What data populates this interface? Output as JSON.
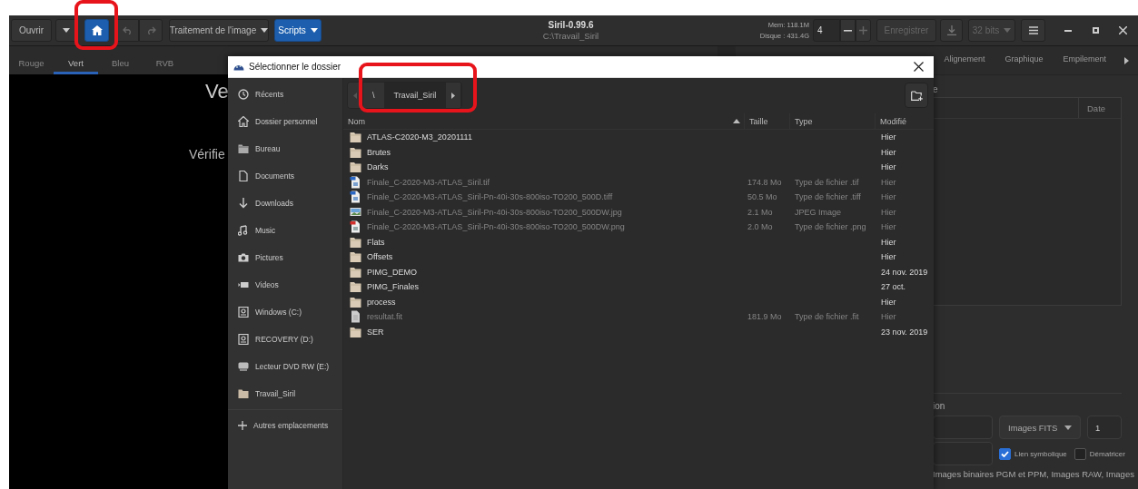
{
  "header": {
    "open_button": "Ouvrir",
    "undo_disabled": true,
    "redo_disabled": true,
    "processing_menu": "Traitement de l'image",
    "scripts_menu": "Scripts",
    "title": "Siril-0.99.6",
    "subtitle": "C:\\Travail_Siril",
    "memory": "Mem: 118.1M",
    "disk": "Disque : 431.4G",
    "threads": "4",
    "save_button": "Enregistrer",
    "save_disabled": true,
    "bit_depth": "32 bits"
  },
  "image_tabs": [
    {
      "label": "Rouge",
      "selected": false
    },
    {
      "label": "Vert",
      "selected": true
    },
    {
      "label": "Bleu",
      "selected": false
    },
    {
      "label": "RVB",
      "selected": false
    }
  ],
  "image_area": {
    "heading": "Ve",
    "message": "Vérifie"
  },
  "panel_tabs": [
    {
      "label": "Alignement",
      "selected": false
    },
    {
      "label": "Graphique",
      "selected": false
    },
    {
      "label": "Empilement",
      "selected": false
    }
  ],
  "panel": {
    "heading": "e",
    "table_column": "Date",
    "section": "ion",
    "file_type": "Images FITS",
    "spin_value": "1",
    "checkboxes": [
      {
        "label": "Lien symbolique",
        "checked": true
      },
      {
        "label": "Dématricer",
        "checked": false
      }
    ],
    "formats": "Images binaires PGM et PPM, Images RAW, Images"
  },
  "dialog": {
    "title": "Sélectionner le dossier",
    "places": [
      {
        "label": "Récents",
        "kind": "recent"
      },
      {
        "label": "Dossier personnel",
        "kind": "home"
      },
      {
        "label": "Bureau",
        "kind": "desktop"
      },
      {
        "label": "Documents",
        "kind": "document"
      },
      {
        "label": "Downloads",
        "kind": "download"
      },
      {
        "label": "Music",
        "kind": "music"
      },
      {
        "label": "Pictures",
        "kind": "pictures"
      },
      {
        "label": "Videos",
        "kind": "videos"
      },
      {
        "label": "Windows (C:)",
        "kind": "drive"
      },
      {
        "label": "RECOVERY (D:)",
        "kind": "drive"
      },
      {
        "label": "Lecteur DVD RW (E:)",
        "kind": "optical"
      },
      {
        "label": "Travail_Siril",
        "kind": "bookmark"
      }
    ],
    "other_locations": "Autres emplacements",
    "path": [
      {
        "label": "\\",
        "selected": false
      },
      {
        "label": "Travail_Siril",
        "selected": true
      }
    ],
    "columns": [
      "Nom",
      "Taille",
      "Type",
      "Modifié"
    ],
    "files": [
      {
        "name": "ATLAS-C2020-M3_20201111",
        "modified": "Hier",
        "kind": "folder",
        "disabled": false
      },
      {
        "name": "Brutes",
        "modified": "Hier",
        "kind": "folder",
        "disabled": false
      },
      {
        "name": "Darks",
        "modified": "Hier",
        "kind": "folder",
        "disabled": false
      },
      {
        "name": "Finale_C-2020-M3-ATLAS_Siril.tif",
        "size": "174.8 Mo",
        "type": "Type de fichier .tif",
        "modified": "Hier",
        "kind": "tiff",
        "disabled": true
      },
      {
        "name": "Finale_C-2020-M3-ATLAS_Siril-Pn-40i-30s-800iso-TO200_500D.tiff",
        "size": "50.5 Mo",
        "type": "Type de fichier .tiff",
        "modified": "Hier",
        "kind": "tiff",
        "disabled": true
      },
      {
        "name": "Finale_C-2020-M3-ATLAS_Siril-Pn-40i-30s-800iso-TO200_500DW.jpg",
        "size": "2.1 Mo",
        "type": "JPEG Image",
        "modified": "Hier",
        "kind": "jpeg",
        "disabled": true
      },
      {
        "name": "Finale_C-2020-M3-ATLAS_Siril-Pn-40i-30s-800iso-TO200_500DW.png",
        "size": "2.0 Mo",
        "type": "Type de fichier .png",
        "modified": "Hier",
        "kind": "png",
        "disabled": true
      },
      {
        "name": "Flats",
        "modified": "Hier",
        "kind": "folder",
        "disabled": false
      },
      {
        "name": "Offsets",
        "modified": "Hier",
        "kind": "folder",
        "disabled": false
      },
      {
        "name": "PIMG_DEMO",
        "modified": "24 nov. 2019",
        "kind": "folder",
        "disabled": false
      },
      {
        "name": "PIMG_Finales",
        "modified": "27 oct.",
        "kind": "folder",
        "disabled": false
      },
      {
        "name": "process",
        "modified": "Hier",
        "kind": "folder",
        "disabled": false
      },
      {
        "name": "resultat.fit",
        "size": "181.9 Mo",
        "type": "Type de fichier .fit",
        "modified": "Hier",
        "kind": "file",
        "disabled": true
      },
      {
        "name": "SER",
        "modified": "23 nov. 2019",
        "kind": "folder",
        "disabled": false
      }
    ]
  }
}
